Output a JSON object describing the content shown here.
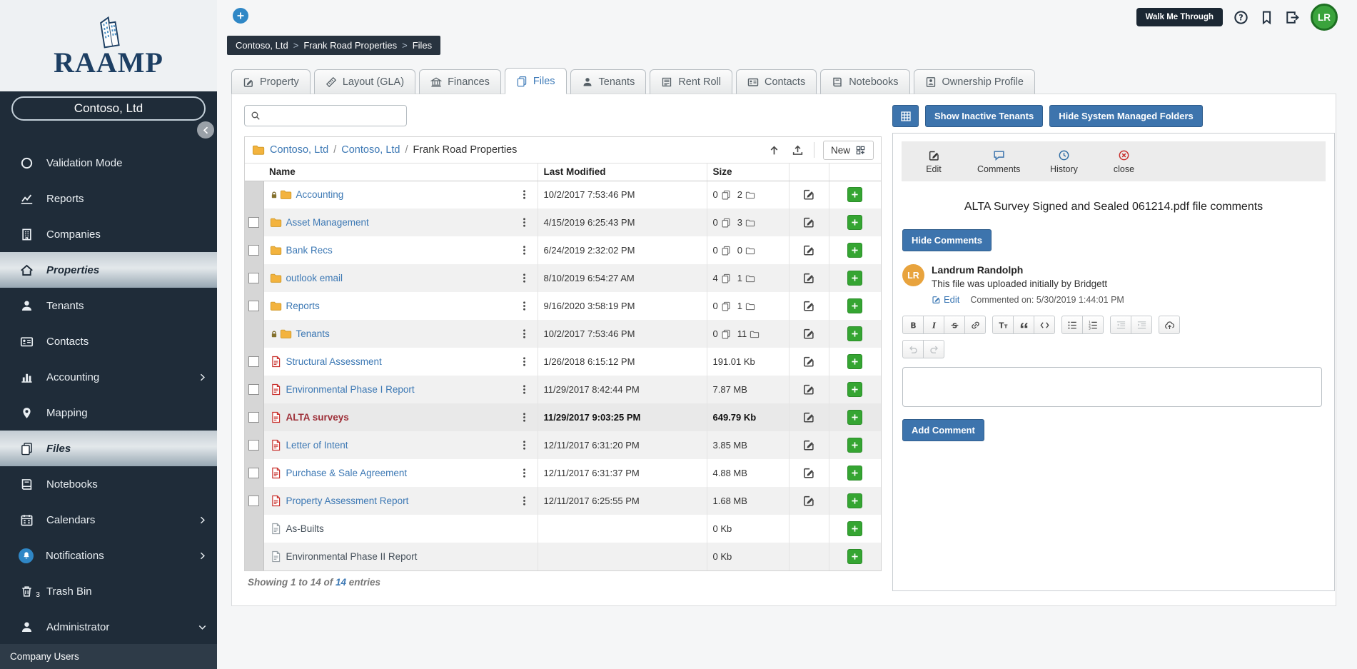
{
  "app": {
    "brand": "RAAMP"
  },
  "sidebar": {
    "brand": "RAAMP",
    "company_label": "Contoso, Ltd",
    "company_users": "Company Users",
    "items": [
      {
        "label": "Validation Mode",
        "icon": "circle-icon"
      },
      {
        "label": "Reports",
        "icon": "line-chart-icon"
      },
      {
        "label": "Companies",
        "icon": "building-icon"
      },
      {
        "label": "Properties",
        "icon": "home-icon",
        "active": true
      },
      {
        "label": "Tenants",
        "icon": "person-icon"
      },
      {
        "label": "Contacts",
        "icon": "id-card-icon"
      },
      {
        "label": "Accounting",
        "icon": "bar-chart-icon",
        "expandable": true
      },
      {
        "label": "Mapping",
        "icon": "map-pin-icon"
      },
      {
        "label": "Files",
        "icon": "files-icon",
        "active": true
      },
      {
        "label": "Notebooks",
        "icon": "notebook-icon"
      },
      {
        "label": "Calendars",
        "icon": "calendar-icon",
        "expandable": true
      },
      {
        "label": "Notifications",
        "icon": "bell-icon",
        "expandable": true
      },
      {
        "label": "Trash Bin",
        "icon": "trash-icon",
        "badge": "3"
      },
      {
        "label": "Administrator",
        "icon": "person-icon",
        "expanded": true
      }
    ]
  },
  "topbar": {
    "walk_me_through": "Walk Me Through",
    "avatar_initials": "LR"
  },
  "breadcrumb": {
    "s0": "Contoso, Ltd",
    "s1": "Frank Road Properties",
    "s2": "Files",
    "sep": ">"
  },
  "tabs": [
    {
      "label": "Property",
      "icon": "edit-icon"
    },
    {
      "label": "Layout (GLA)",
      "icon": "ruler-icon"
    },
    {
      "label": "Finances",
      "icon": "bank-icon"
    },
    {
      "label": "Files",
      "icon": "copy-icon",
      "active": true
    },
    {
      "label": "Tenants",
      "icon": "person-icon"
    },
    {
      "label": "Rent Roll",
      "icon": "form-icon"
    },
    {
      "label": "Contacts",
      "icon": "id-card-icon"
    },
    {
      "label": "Notebooks",
      "icon": "notebook-icon"
    },
    {
      "label": "Ownership Profile",
      "icon": "profile-doc-icon"
    }
  ],
  "files": {
    "search_placeholder": "",
    "path": {
      "link1": "Contoso, Ltd",
      "link2": "Contoso, Ltd",
      "current": "Frank Road Properties",
      "sep": "/"
    },
    "new_button": "New",
    "columns": {
      "name": "Name",
      "modified": "Last Modified",
      "size": "Size"
    },
    "rows": [
      {
        "name": "Accounting",
        "type": "folder",
        "locked": true,
        "checkbox": false,
        "modified": "10/2/2017 7:53:46 PM",
        "files_count": "0",
        "folders_count": "2"
      },
      {
        "name": "Asset Management",
        "type": "folder",
        "checkbox": true,
        "modified": "4/15/2019 6:25:43 PM",
        "files_count": "0",
        "folders_count": "3"
      },
      {
        "name": "Bank Recs",
        "type": "folder",
        "checkbox": true,
        "modified": "6/24/2019 2:32:02 PM",
        "files_count": "0",
        "folders_count": "0"
      },
      {
        "name": "outlook email",
        "type": "folder",
        "checkbox": true,
        "modified": "8/10/2019 6:54:27 AM",
        "files_count": "4",
        "folders_count": "1"
      },
      {
        "name": "Reports",
        "type": "folder",
        "checkbox": true,
        "modified": "9/16/2020 3:58:19 PM",
        "files_count": "0",
        "folders_count": "1"
      },
      {
        "name": "Tenants",
        "type": "folder",
        "locked": true,
        "checkbox": false,
        "modified": "10/2/2017 7:53:46 PM",
        "files_count": "0",
        "folders_count": "11"
      },
      {
        "name": "Structural Assessment",
        "type": "pdf",
        "checkbox": true,
        "modified": "1/26/2018 6:15:12 PM",
        "size": "191.01 Kb"
      },
      {
        "name": "Environmental Phase I Report",
        "type": "pdf",
        "checkbox": true,
        "modified": "11/29/2017 8:42:44 PM",
        "size": "7.87 MB"
      },
      {
        "name": "ALTA surveys",
        "type": "pdf",
        "checkbox": true,
        "selected": true,
        "modified": "11/29/2017 9:03:25 PM",
        "size": "649.79 Kb"
      },
      {
        "name": "Letter of Intent",
        "type": "pdf",
        "checkbox": true,
        "modified": "12/11/2017 6:31:20 PM",
        "size": "3.85 MB"
      },
      {
        "name": "Purchase & Sale Agreement",
        "type": "pdf",
        "checkbox": true,
        "modified": "12/11/2017 6:31:37 PM",
        "size": "4.88 MB"
      },
      {
        "name": "Property Assessment Report",
        "type": "pdf",
        "checkbox": true,
        "modified": "12/11/2017 6:25:55 PM",
        "size": "1.68 MB"
      },
      {
        "name": "As-Builts",
        "type": "file",
        "checkbox": false,
        "modified": "",
        "size": "0 Kb"
      },
      {
        "name": "Environmental Phase II Report",
        "type": "file",
        "checkbox": false,
        "modified": "",
        "size": "0 Kb"
      }
    ],
    "footer": {
      "prefix": "Showing 1 to 14 of ",
      "total": "14",
      "suffix": " entries"
    }
  },
  "comments_panel": {
    "show_inactive_tenants": "Show Inactive Tenants",
    "hide_system_managed": "Hide System Managed Folders",
    "actions": {
      "edit": "Edit",
      "comments": "Comments",
      "history": "History",
      "close": "close"
    },
    "title": "ALTA Survey Signed and Sealed 061214.pdf file comments",
    "hide_comments": "Hide Comments",
    "comment": {
      "initials": "LR",
      "author": "Landrum Randolph",
      "body": "This file was uploaded initially by Bridgett",
      "edit_link": "Edit",
      "meta": "Commented on: 5/30/2019 1:44:01 PM"
    },
    "add_comment": "Add Comment"
  },
  "colors": {
    "accent_blue": "#3d74ad",
    "dark_navy": "#1f2c39",
    "green_add": "#35a532",
    "link_blue": "#3c78b4",
    "folder_orange": "#f3b33e",
    "pdf_red": "#c9302c",
    "selected_file_name": "#9e3039",
    "avatar_green": "#3aa33c",
    "comment_avatar_orange": "#e8a33d"
  }
}
